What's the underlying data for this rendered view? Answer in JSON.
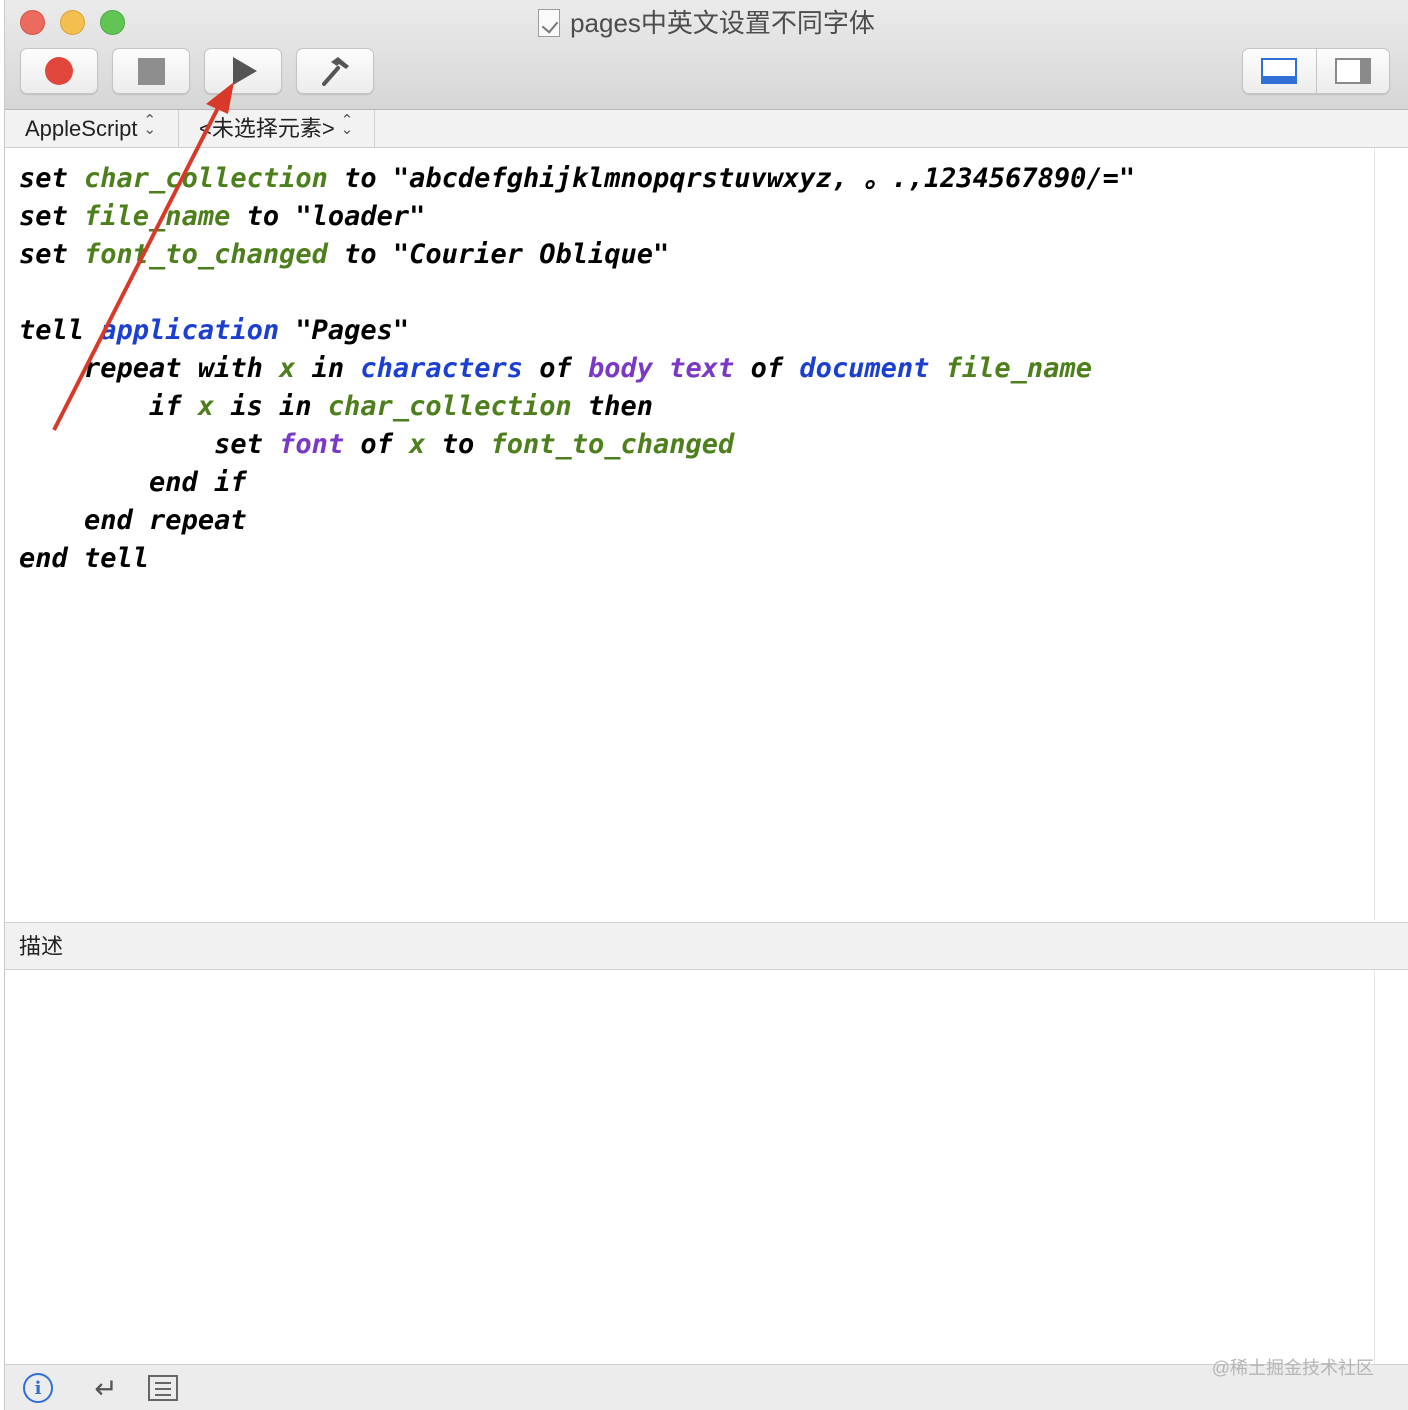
{
  "window": {
    "title": "pages中英文设置不同字体"
  },
  "toolbar": {
    "record_label": "Record",
    "stop_label": "Stop",
    "run_label": "Run",
    "compile_label": "Compile"
  },
  "navbar": {
    "language": "AppleScript",
    "element": "<未选择元素>"
  },
  "code_lines": [
    {
      "indent": "",
      "tokens": [
        [
          "kw",
          "set "
        ],
        [
          "var",
          "char_collection"
        ],
        [
          "kw",
          " to "
        ],
        [
          "str",
          "\"abcdefghijklmnopqrstuvwxyz, 。.,1234567890/=\""
        ]
      ]
    },
    {
      "indent": "",
      "tokens": [
        [
          "kw",
          "set "
        ],
        [
          "var",
          "file_name"
        ],
        [
          "kw",
          " to "
        ],
        [
          "str",
          "\"loader\""
        ]
      ]
    },
    {
      "indent": "",
      "tokens": [
        [
          "kw",
          "set "
        ],
        [
          "var",
          "font_to_changed"
        ],
        [
          "kw",
          " to "
        ],
        [
          "str",
          "\"Courier Oblique\""
        ]
      ]
    },
    {
      "indent": "",
      "tokens": []
    },
    {
      "indent": "",
      "tokens": [
        [
          "kw",
          "tell "
        ],
        [
          "app",
          "application"
        ],
        [
          "kw",
          " "
        ],
        [
          "str",
          "\"Pages\""
        ]
      ]
    },
    {
      "indent": "    ",
      "tokens": [
        [
          "kw",
          "repeat with "
        ],
        [
          "var",
          "x"
        ],
        [
          "kw",
          " in "
        ],
        [
          "app",
          "characters"
        ],
        [
          "kw",
          " of "
        ],
        [
          "prop",
          "body text"
        ],
        [
          "kw",
          " of "
        ],
        [
          "app",
          "document"
        ],
        [
          "kw",
          " "
        ],
        [
          "var",
          "file_name"
        ]
      ]
    },
    {
      "indent": "        ",
      "tokens": [
        [
          "kw",
          "if "
        ],
        [
          "var",
          "x"
        ],
        [
          "kw",
          " is in "
        ],
        [
          "var",
          "char_collection"
        ],
        [
          "kw",
          " then"
        ]
      ]
    },
    {
      "indent": "            ",
      "tokens": [
        [
          "kw",
          "set "
        ],
        [
          "prop",
          "font"
        ],
        [
          "kw",
          " of "
        ],
        [
          "var",
          "x"
        ],
        [
          "kw",
          " to "
        ],
        [
          "var",
          "font_to_changed"
        ]
      ]
    },
    {
      "indent": "        ",
      "tokens": [
        [
          "kw",
          "end if"
        ]
      ]
    },
    {
      "indent": "    ",
      "tokens": [
        [
          "kw",
          "end repeat"
        ]
      ]
    },
    {
      "indent": "",
      "tokens": [
        [
          "kw",
          "end tell"
        ]
      ]
    }
  ],
  "description": {
    "header": "描述",
    "body": ""
  },
  "watermark": "@稀土掘金技术社区",
  "annotation": {
    "arrow_color": "#d83a2a",
    "target": "run-button"
  },
  "colors": {
    "variable": "#4d7f1c",
    "application_class": "#1b3fd1",
    "property": "#7a38c7",
    "keyword": "#000000"
  }
}
